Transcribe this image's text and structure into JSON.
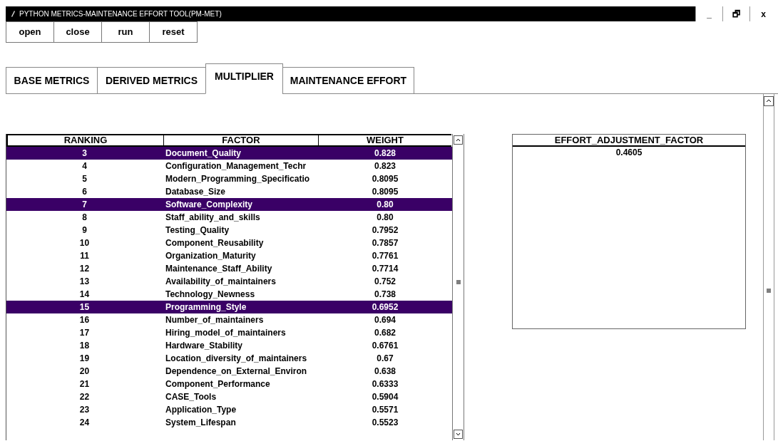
{
  "window": {
    "title": "PYTHON METRICS-MAINTENANCE EFFORT TOOL(PM-MET)",
    "controls": [
      "_",
      "🗗",
      "x"
    ]
  },
  "toolbar": [
    "open",
    "close",
    "run",
    "reset"
  ],
  "tabs": [
    {
      "label": "BASE METRICS",
      "selected": false
    },
    {
      "label": "DERIVED METRICS",
      "selected": false
    },
    {
      "label": "MULTIPLIER",
      "selected": true
    },
    {
      "label": "MAINTENANCE EFFORT",
      "selected": false
    }
  ],
  "table": {
    "columns": [
      "RANKING",
      "FACTOR",
      "WEIGHT"
    ],
    "rows": [
      {
        "cells": [
          "3",
          "Document_Quality",
          "0.828"
        ],
        "selected": true
      },
      {
        "cells": [
          "4",
          "Configuration_Management_Techr",
          "0.823"
        ],
        "selected": false
      },
      {
        "cells": [
          "5",
          "Modern_Programming_Specificatio",
          "0.8095"
        ],
        "selected": false
      },
      {
        "cells": [
          "6",
          "Database_Size",
          "0.8095"
        ],
        "selected": false
      },
      {
        "cells": [
          "7",
          "Software_Complexity",
          "0.80"
        ],
        "selected": true
      },
      {
        "cells": [
          "8",
          "Staff_ability_and_skills",
          "0.80"
        ],
        "selected": false
      },
      {
        "cells": [
          "9",
          "Testing_Quality",
          "0.7952"
        ],
        "selected": false
      },
      {
        "cells": [
          "10",
          "Component_Reusability",
          "0.7857"
        ],
        "selected": false
      },
      {
        "cells": [
          "11",
          "Organization_Maturity",
          "0.7761"
        ],
        "selected": false
      },
      {
        "cells": [
          "12",
          "Maintenance_Staff_Ability",
          "0.7714"
        ],
        "selected": false
      },
      {
        "cells": [
          "13",
          "Availability_of_maintainers",
          "0.752"
        ],
        "selected": false
      },
      {
        "cells": [
          "14",
          "Technology_Newness",
          "0.738"
        ],
        "selected": false
      },
      {
        "cells": [
          "15",
          "Programming_Style",
          "0.6952"
        ],
        "selected": true
      },
      {
        "cells": [
          "16",
          "Number_of_maintainers",
          "0.694"
        ],
        "selected": false
      },
      {
        "cells": [
          "17",
          "Hiring_model_of_maintainers",
          "0.682"
        ],
        "selected": false
      },
      {
        "cells": [
          "18",
          "Hardware_Stability",
          "0.6761"
        ],
        "selected": false
      },
      {
        "cells": [
          "19",
          "Location_diversity_of_maintainers",
          "0.67"
        ],
        "selected": false
      },
      {
        "cells": [
          "20",
          "Dependence_on_External_Environ",
          "0.638"
        ],
        "selected": false
      },
      {
        "cells": [
          "21",
          "Component_Performance",
          "0.6333"
        ],
        "selected": false
      },
      {
        "cells": [
          "22",
          "CASE_Tools",
          "0.5904"
        ],
        "selected": false
      },
      {
        "cells": [
          "23",
          "Application_Type",
          "0.5571"
        ],
        "selected": false
      },
      {
        "cells": [
          "24",
          "System_Lifespan",
          "0.5523"
        ],
        "selected": false
      }
    ]
  },
  "effort": {
    "heading": "EFFORT_ADJUSTMENT_FACTOR",
    "value": "0.4605"
  }
}
